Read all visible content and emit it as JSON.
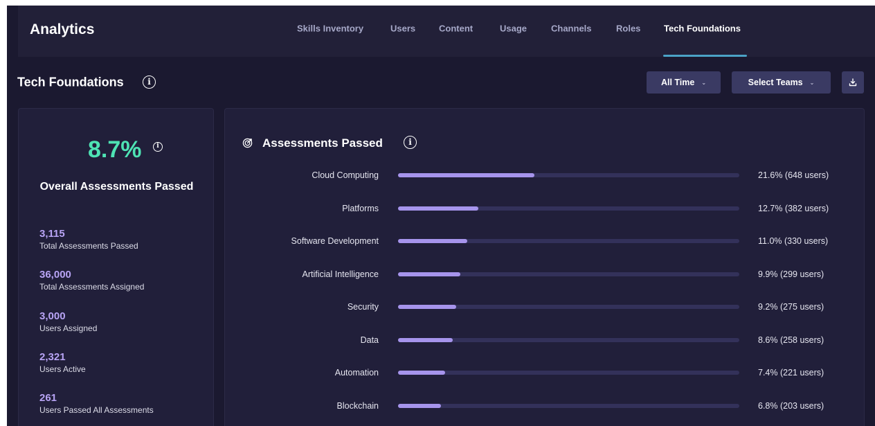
{
  "header": {
    "title": "Analytics",
    "tabs": [
      {
        "label": "Skills Inventory",
        "active": false
      },
      {
        "label": "Users",
        "active": false
      },
      {
        "label": "Content",
        "active": false
      },
      {
        "label": "Usage",
        "active": false
      },
      {
        "label": "Channels",
        "active": false
      },
      {
        "label": "Roles",
        "active": false
      },
      {
        "label": "Tech Foundations",
        "active": true
      }
    ]
  },
  "page": {
    "title": "Tech Foundations",
    "time_filter": "All Time",
    "team_filter": "Select Teams",
    "icons": {
      "info": "info-icon",
      "download": "download-icon",
      "assessments": "target-icon"
    }
  },
  "summary": {
    "overall_pct": "8.7%",
    "overall_label": "Overall Assessments Passed",
    "stats": [
      {
        "value": "3,115",
        "label": "Total Assessments Passed"
      },
      {
        "value": "36,000",
        "label": "Total Assessments Assigned"
      },
      {
        "value": "3,000",
        "label": "Users Assigned"
      },
      {
        "value": "2,321",
        "label": "Users Active"
      },
      {
        "value": "261",
        "label": "Users Passed All Assessments"
      }
    ]
  },
  "assessments": {
    "title": "Assessments Passed",
    "rows": [
      {
        "label": "Cloud Computing",
        "pct": 21.6,
        "text": "21.6% (648 users)"
      },
      {
        "label": "Platforms",
        "pct": 12.7,
        "text": "12.7% (382 users)"
      },
      {
        "label": "Software Development",
        "pct": 11.0,
        "text": "11.0% (330 users)"
      },
      {
        "label": "Artificial Intelligence",
        "pct": 9.9,
        "text": "9.9% (299 users)"
      },
      {
        "label": "Security",
        "pct": 9.2,
        "text": "9.2% (275 users)"
      },
      {
        "label": "Data",
        "pct": 8.6,
        "text": "8.6% (258 users)"
      },
      {
        "label": "Automation",
        "pct": 7.4,
        "text": "7.4% (221 users)"
      },
      {
        "label": "Blockchain",
        "pct": 6.8,
        "text": "6.8% (203 users)"
      }
    ]
  },
  "colors": {
    "accent_green": "#4ee3b4",
    "accent_purple": "#b8a4f5",
    "bar_fill": "#a694ec",
    "tab_underline": "#4ba3c7"
  }
}
